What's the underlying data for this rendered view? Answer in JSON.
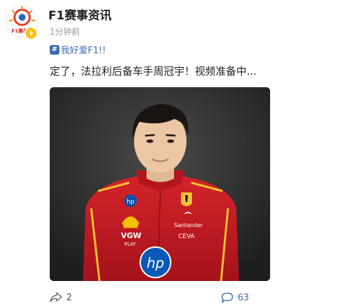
{
  "post": {
    "author": "F1赛事资讯",
    "avatar_text": "F1赛事资",
    "time": "1分钟前",
    "topic": "我好爱F1!!",
    "content": "定了，法拉利后备车手周冠宇！视频准备中...",
    "photo_labels": {
      "hp": "hp",
      "vgw": "VGW",
      "play": "PLAY",
      "santander": "Santander",
      "ceva": "CEVA"
    },
    "actions": {
      "share_count": "2",
      "comment_count": "63"
    }
  },
  "colors": {
    "link": "#3d6fb0",
    "suit_red": "#c8191f",
    "badge": "#f7c21b"
  }
}
